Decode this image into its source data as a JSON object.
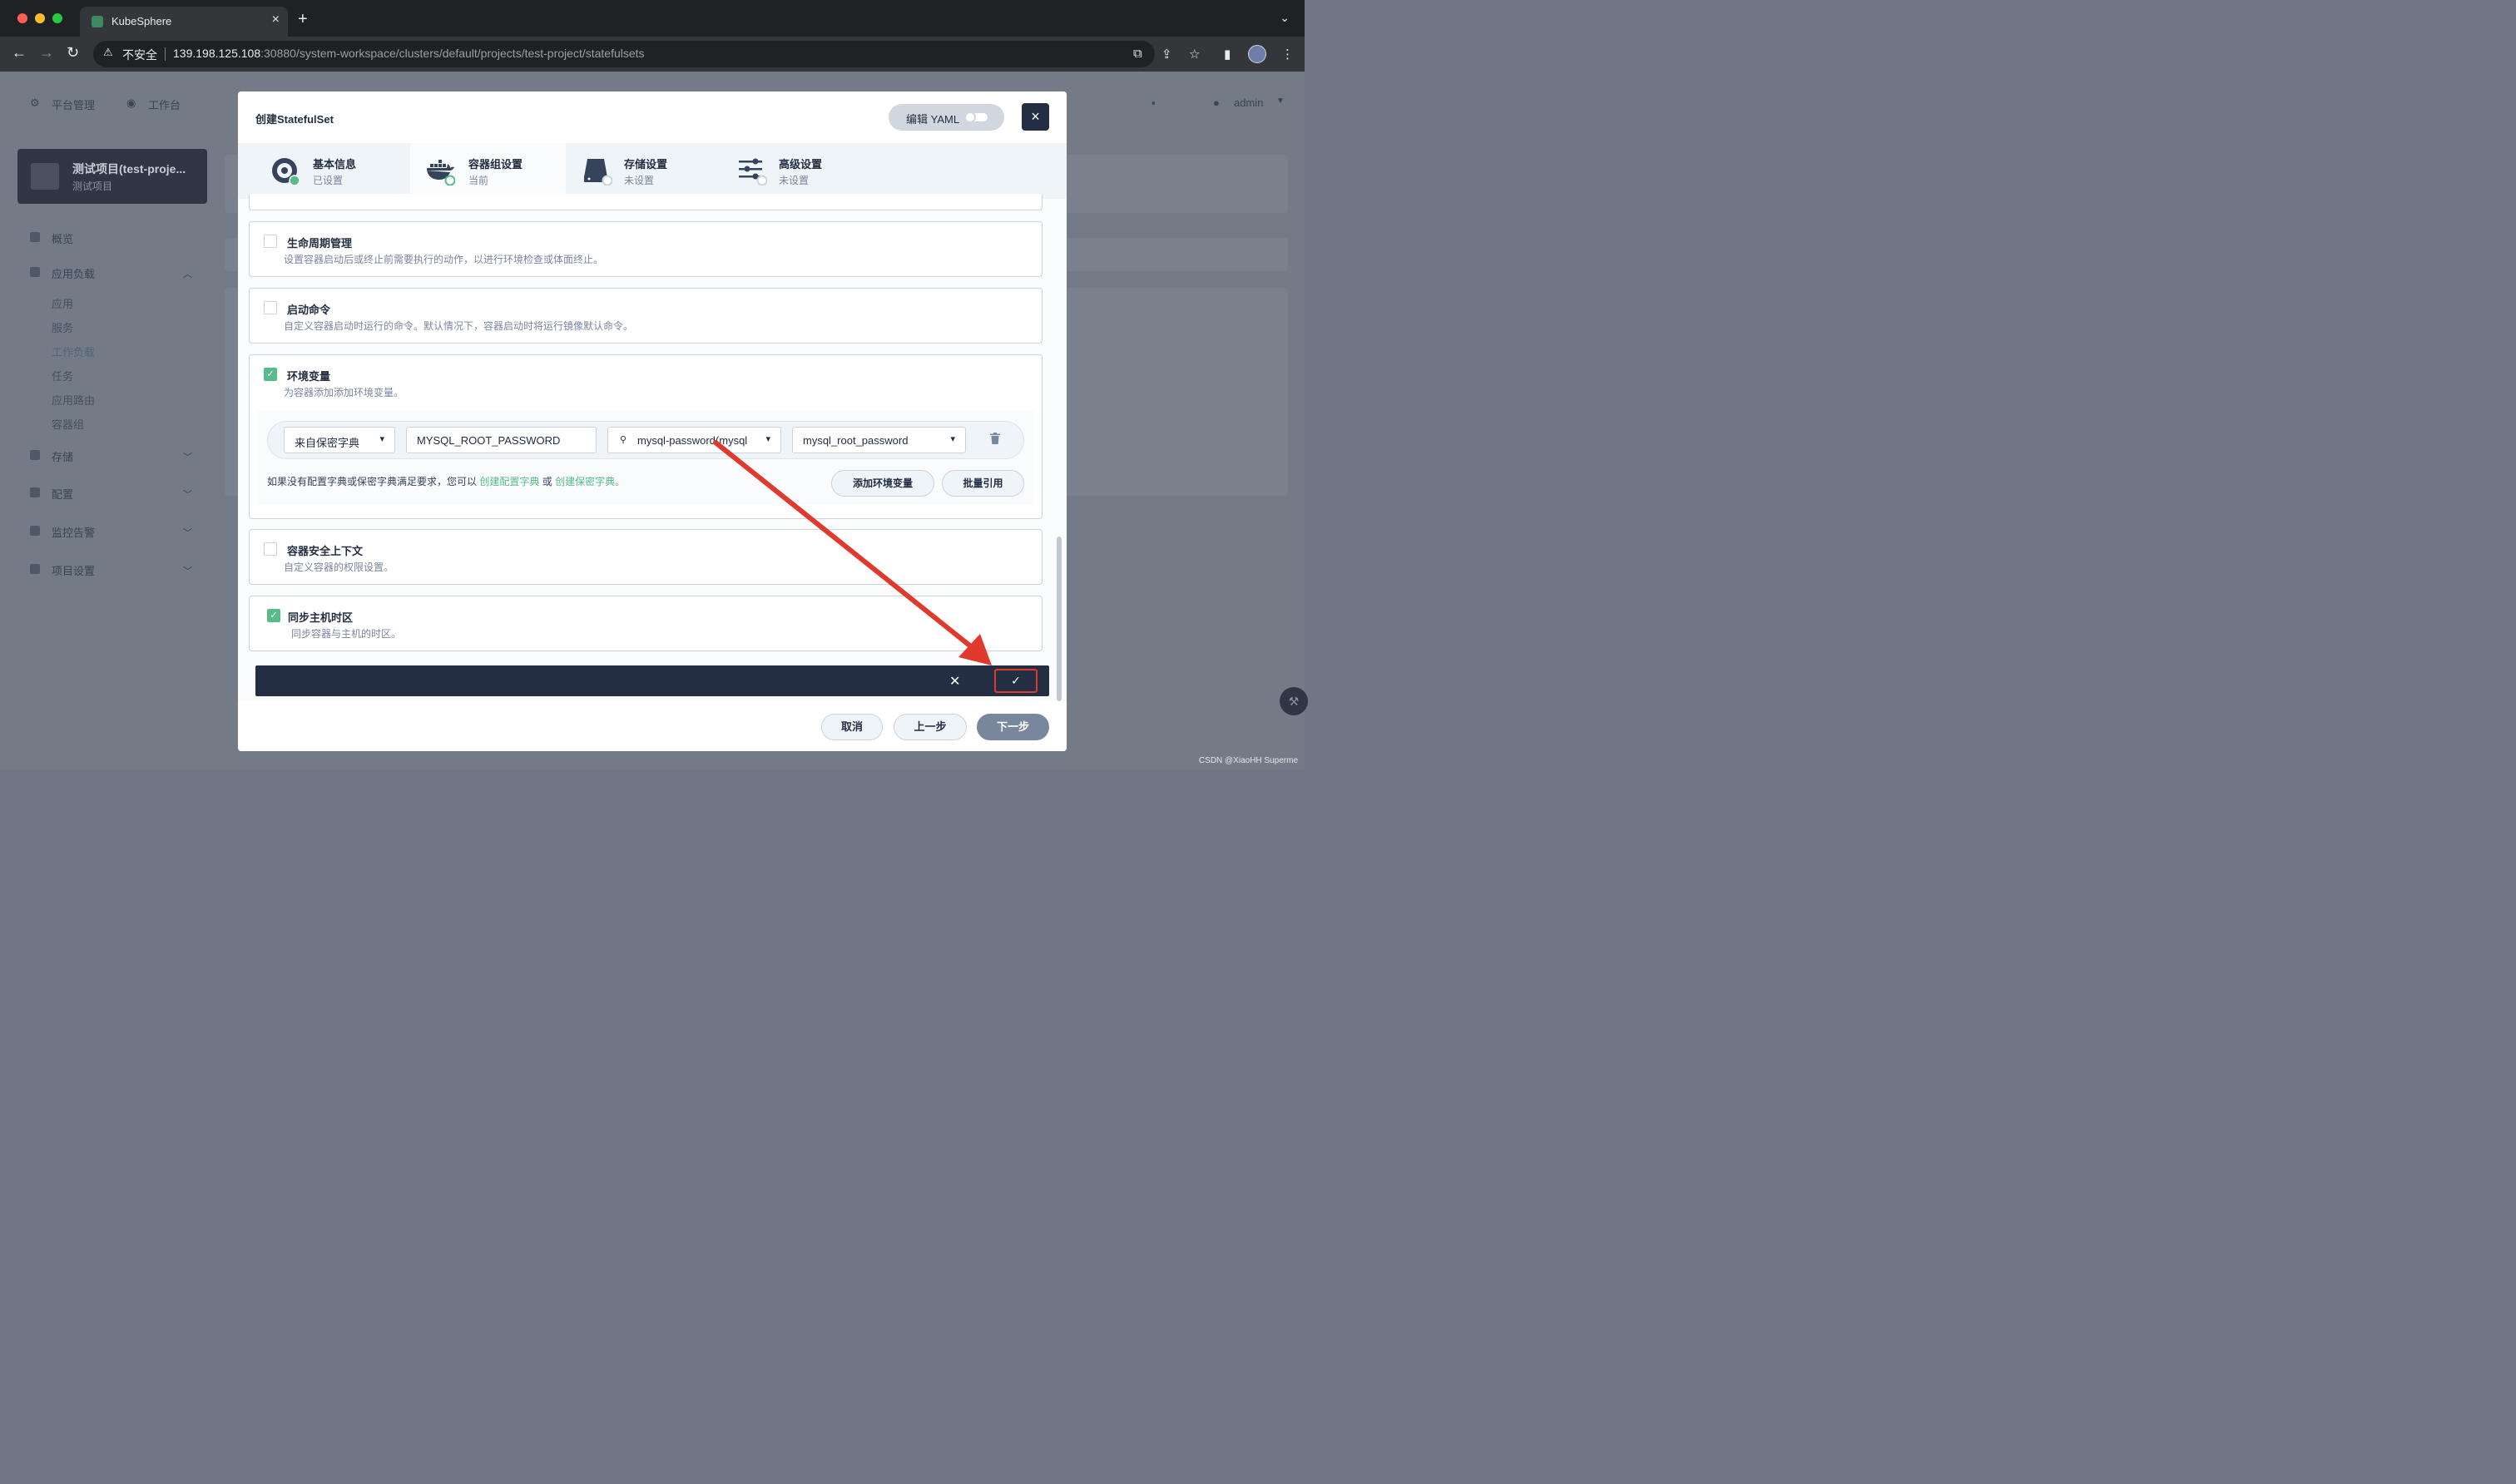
{
  "browser": {
    "tab_title": "KubeSphere",
    "insecure_label": "不安全",
    "url_host": "139.198.125.108",
    "url_path": ":30880/system-workspace/clusters/default/projects/test-project/statefulsets"
  },
  "app_bg": {
    "topnav": [
      "平台管理",
      "工作台"
    ],
    "user": "admin",
    "project_name": "测试项目(test-proje...",
    "project_sub": "测试项目",
    "sidebar": [
      {
        "label": "概览"
      },
      {
        "label": "应用负载"
      },
      {
        "label": "存储"
      },
      {
        "label": "配置"
      },
      {
        "label": "监控告警"
      },
      {
        "label": "项目设置"
      }
    ],
    "workload_items": [
      "应用",
      "服务",
      "工作负载",
      "任务",
      "应用路由",
      "容器组"
    ]
  },
  "modal": {
    "title": "创建StatefulSet",
    "yaml_label": "编辑 YAML",
    "close_icon": "×",
    "steps": [
      {
        "title": "基本信息",
        "status": "已设置"
      },
      {
        "title": "容器组设置",
        "status": "当前"
      },
      {
        "title": "存储设置",
        "status": "未设置"
      },
      {
        "title": "高级设置",
        "status": "未设置"
      }
    ],
    "sections": {
      "lifecycle": {
        "title": "生命周期管理",
        "desc": "设置容器启动后或终止前需要执行的动作，以进行环境检查或体面终止。",
        "checked": false
      },
      "startup": {
        "title": "启动命令",
        "desc": "自定义容器启动时运行的命令。默认情况下，容器启动时将运行镜像默认命令。",
        "checked": false
      },
      "env": {
        "title": "环境变量",
        "desc": "为容器添加添加环境变量。",
        "checked": true
      },
      "security": {
        "title": "容器安全上下文",
        "desc": "自定义容器的权限设置。",
        "checked": false
      },
      "timezone": {
        "title": "同步主机时区",
        "desc": "同步容器与主机的时区。",
        "checked": true
      }
    },
    "env_row": {
      "source": "来自保密字典",
      "name": "MYSQL_ROOT_PASSWORD",
      "secret": "mysql-password(mysql",
      "key": "mysql_root_password"
    },
    "env_hint": {
      "prefix": "如果没有配置字典或保密字典满足要求，您可以",
      "link1": "创建配置字典",
      "or": "或",
      "link2": "创建保密字典",
      "suffix": "。"
    },
    "add_env_label": "添加环境变量",
    "batch_ref_label": "批量引用",
    "savebar": {
      "cancel_icon": "✕",
      "confirm_icon": "✓"
    },
    "footer": {
      "cancel": "取消",
      "prev": "上一步",
      "next": "下一步"
    }
  },
  "watermark": "CSDN @XiaoHH Superme",
  "colors": {
    "accent": "#55bc8a",
    "dark": "#242e42",
    "annotation_red": "#e0392e"
  }
}
